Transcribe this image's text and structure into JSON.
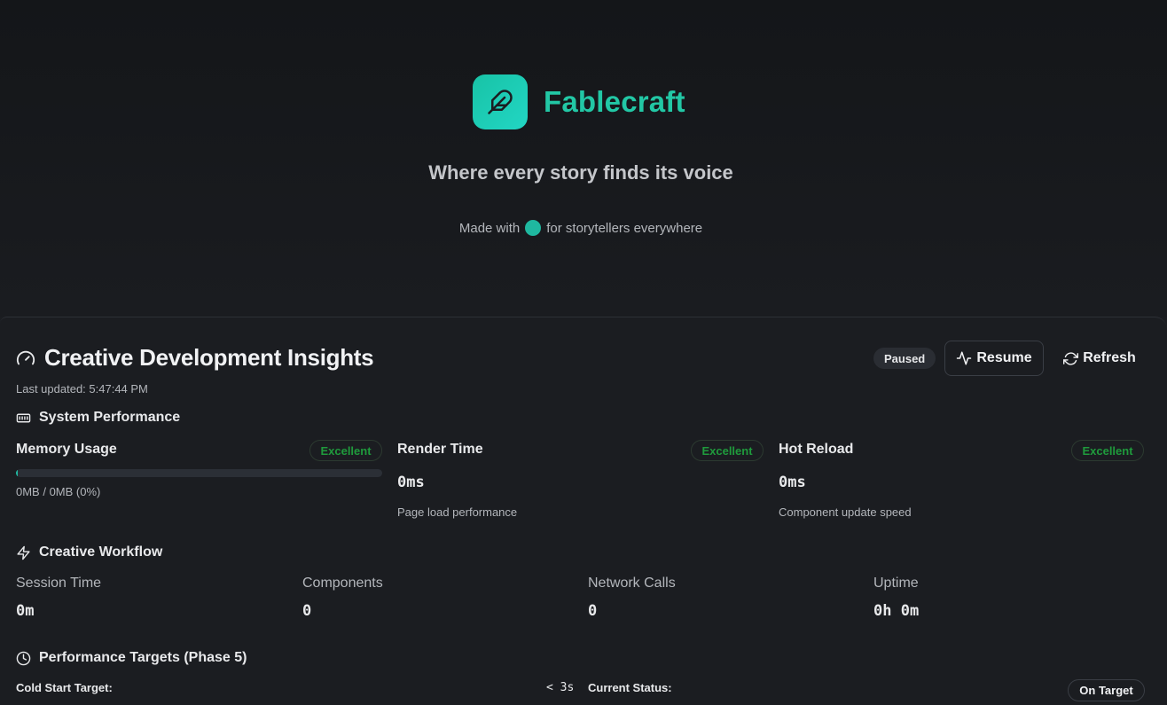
{
  "brand": {
    "name": "Fablecraft",
    "tagline": "Where every story finds its voice",
    "made_with_prefix": "Made with",
    "made_with_suffix": "for storytellers everywhere",
    "accent_color": "#22c7a5"
  },
  "insights": {
    "title": "Creative Development Insights",
    "last_updated": "Last updated: 5:47:44 PM",
    "status_badge": "Paused",
    "resume_label": "Resume",
    "refresh_label": "Refresh"
  },
  "system_performance": {
    "heading": "System Performance",
    "metrics": [
      {
        "label": "Memory Usage",
        "status": "Excellent",
        "value": "",
        "sub": "0MB / 0MB (0%)",
        "percent": 0
      },
      {
        "label": "Render Time",
        "status": "Excellent",
        "value": "0ms",
        "sub": "Page load performance"
      },
      {
        "label": "Hot Reload",
        "status": "Excellent",
        "value": "0ms",
        "sub": "Component update speed"
      }
    ],
    "status_color": "#1f9a3c"
  },
  "creative_workflow": {
    "heading": "Creative Workflow",
    "stats": [
      {
        "label": "Session Time",
        "value": "0m"
      },
      {
        "label": "Components",
        "value": "0"
      },
      {
        "label": "Network Calls",
        "value": "0"
      },
      {
        "label": "Uptime",
        "value": "0h 0m"
      }
    ]
  },
  "performance_targets": {
    "heading": "Performance Targets (Phase 5)",
    "cold_start_label": "Cold Start Target:",
    "cold_start_value": "< 3s",
    "current_status_label": "Current Status:",
    "current_status_value": "On Target"
  },
  "icons": [
    "feather-icon",
    "gauge-icon",
    "memory-icon",
    "activity-icon",
    "refresh-icon",
    "zap-icon",
    "clock-icon"
  ]
}
